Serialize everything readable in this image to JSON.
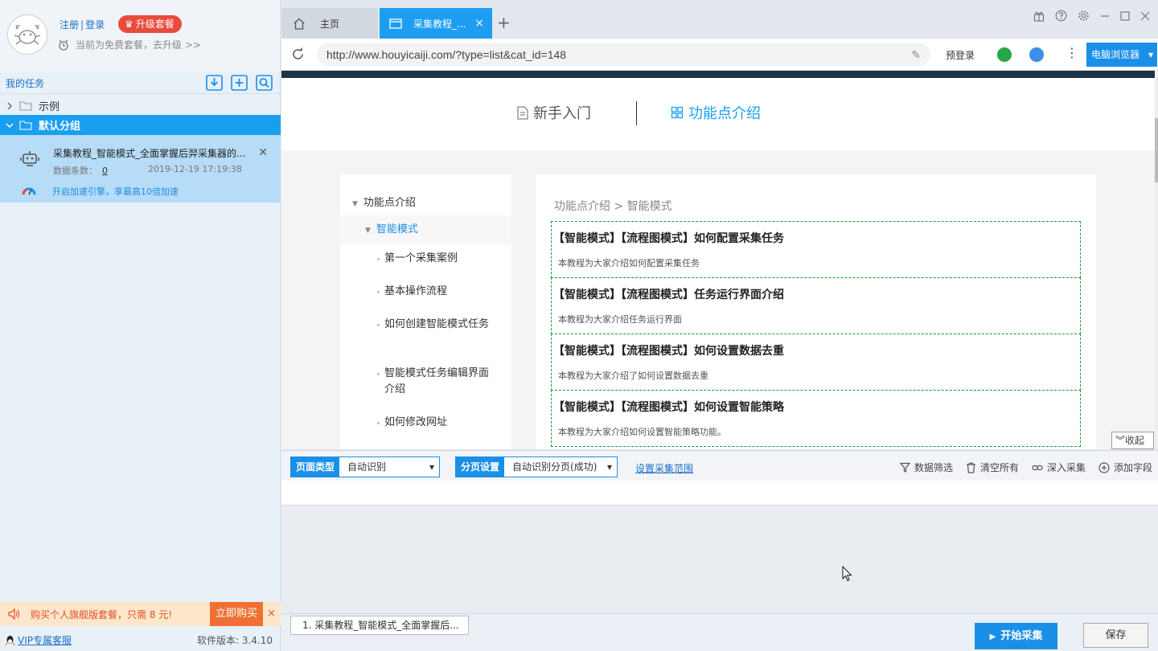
{
  "account": {
    "register": "注册",
    "separator": "|",
    "login": "登录",
    "upgrade": "升级套餐",
    "plan_text": "当前为免费套餐，去升级 >>"
  },
  "sidebar": {
    "my_tasks": "我的任务",
    "groups": [
      {
        "name": "示例",
        "expanded": false
      },
      {
        "name": "默认分组",
        "expanded": true
      }
    ],
    "task": {
      "title": "采集教程_智能模式_全面掌握后羿采集器的...",
      "count_label": "数据条数：",
      "count": "0",
      "time": "2019-12-19 17:19:38",
      "speed_text": "开启加速引擎，享最高10倍加速"
    },
    "promo": {
      "text": "购买个人旗舰版套餐，只需 8 元!",
      "button": "立即购买",
      "close": "×"
    },
    "footer": {
      "vip": "VIP专属客服",
      "version": "软件版本: 3.4.10"
    }
  },
  "tabs": [
    {
      "label": "主页",
      "active": false
    },
    {
      "label": "采集教程_...",
      "active": true
    }
  ],
  "tab_close": "×",
  "tab_add": "+",
  "address": {
    "url": "http://www.houyicaiji.com/?type=list&cat_id=148",
    "prelogin": "预登录",
    "browser_mode": "电脑浏览器"
  },
  "web": {
    "guide_left": "新手入门",
    "guide_right": "功能点介绍",
    "nav": {
      "root": "功能点介绍",
      "mode": "智能模式",
      "items": [
        "第一个采集案例",
        "基本操作流程",
        "如何创建智能模式任务",
        "智能模式任务编辑界面介绍",
        "如何修改网址"
      ]
    },
    "breadcrumb": "功能点介绍 > 智能模式",
    "articles": [
      {
        "title": "【智能模式】【流程图模式】如何配置采集任务",
        "desc": "本教程为大家介绍如何配置采集任务"
      },
      {
        "title": "【智能模式】【流程图模式】任务运行界面介绍",
        "desc": "本教程为大家介绍任务运行界面"
      },
      {
        "title": "【智能模式】【流程图模式】如何设置数据去重",
        "desc": "本教程为大家介绍了如何设置数据去重"
      },
      {
        "title": "【智能模式】【流程图模式】如何设置智能策略",
        "desc": "本教程为大家介绍如何设置智能策略功能。"
      }
    ],
    "collapse": "收起"
  },
  "toolbar": {
    "page_type_label": "页面类型",
    "page_type_value": "自动识别",
    "paging_label": "分页设置",
    "paging_value": "自动识别分页(成功)",
    "range_link": "设置采集范围",
    "filter": "数据筛选",
    "clear": "清空所有",
    "deep": "深入采集",
    "add_field": "添加字段"
  },
  "status": {
    "task_chip": "1. 采集教程_智能模式_全面掌握后...",
    "start": "开始采集",
    "save": "保存"
  },
  "colors": {
    "accent": "#1a9ff0",
    "promo_bg": "#fde7cc",
    "promo_btn": "#f07033",
    "upgrade_bg": "#e84b3c",
    "article_border": "#1a9d3a"
  }
}
